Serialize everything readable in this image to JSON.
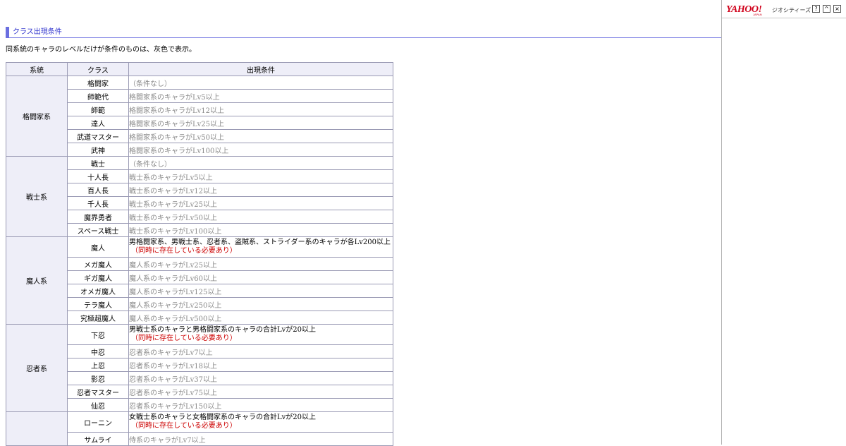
{
  "section_title": "クラス出現条件",
  "note": "同系統のキャラのレベルだけが条件のものは、灰色で表示。",
  "table": {
    "headers": [
      "系統",
      "クラス",
      "出現条件"
    ],
    "groups": [
      {
        "name": "格闘家系",
        "rows": [
          {
            "cls": "格闘家",
            "cond": "（条件なし）"
          },
          {
            "cls": "師範代",
            "cond": "格闘家系のキャラがLv5以上"
          },
          {
            "cls": "師範",
            "cond": "格闘家系のキャラがLv12以上"
          },
          {
            "cls": "達人",
            "cond": "格闘家系のキャラがLv25以上"
          },
          {
            "cls": "武道マスター",
            "cond": "格闘家系のキャラがLv50以上"
          },
          {
            "cls": "武神",
            "cond": "格闘家系のキャラがLv100以上"
          }
        ]
      },
      {
        "name": "戦士系",
        "rows": [
          {
            "cls": "戦士",
            "cond": "（条件なし）"
          },
          {
            "cls": "十人長",
            "cond": "戦士系のキャラがLv5以上"
          },
          {
            "cls": "百人長",
            "cond": "戦士系のキャラがLv12以上"
          },
          {
            "cls": "千人長",
            "cond": "戦士系のキャラがLv25以上"
          },
          {
            "cls": "魔界勇者",
            "cond": "戦士系のキャラがLv50以上"
          },
          {
            "cls": "スペース戦士",
            "cond": "戦士系のキャラがLv100以上"
          }
        ]
      },
      {
        "name": "魔人系",
        "rows": [
          {
            "cls": "魔人",
            "cond": "男格闘家系、男戦士系、忍者系、盗賊系、ストライダー系のキャラが各Lv200以上",
            "req": "（同時に存在している必要あり）"
          },
          {
            "cls": "メガ魔人",
            "cond": "魔人系のキャラがLv25以上"
          },
          {
            "cls": "ギガ魔人",
            "cond": "魔人系のキャラがLv60以上"
          },
          {
            "cls": "オメガ魔人",
            "cond": "魔人系のキャラがLv125以上"
          },
          {
            "cls": "テラ魔人",
            "cond": "魔人系のキャラがLv250以上"
          },
          {
            "cls": "究極超魔人",
            "cond": "魔人系のキャラがLv500以上"
          }
        ]
      },
      {
        "name": "忍者系",
        "rows": [
          {
            "cls": "下忍",
            "cond": "男戦士系のキャラと男格闘家系のキャラの合計Lvが20以上",
            "req": "（同時に存在している必要あり）"
          },
          {
            "cls": "中忍",
            "cond": "忍者系のキャラがLv7以上"
          },
          {
            "cls": "上忍",
            "cond": "忍者系のキャラがLv18以上"
          },
          {
            "cls": "影忍",
            "cond": "忍者系のキャラがLv37以上"
          },
          {
            "cls": "忍者マスター",
            "cond": "忍者系のキャラがLv75以上"
          },
          {
            "cls": "仙忍",
            "cond": "忍者系のキャラがLv150以上"
          }
        ]
      },
      {
        "name": "",
        "rows": [
          {
            "cls": "ローニン",
            "cond": "女戦士系のキャラと女格闘家系のキャラの合計Lvが20以上",
            "req": "（同時に存在している必要あり）"
          },
          {
            "cls": "サムライ",
            "cond": "侍系のキャラがLv7以上"
          }
        ]
      }
    ]
  },
  "sidebar": {
    "logo": "YAHOO!",
    "logo_sub": "JAPAN",
    "service": "ジオシティーズ",
    "buttons": {
      "help": "?",
      "collapse": "^",
      "close": "×"
    }
  }
}
